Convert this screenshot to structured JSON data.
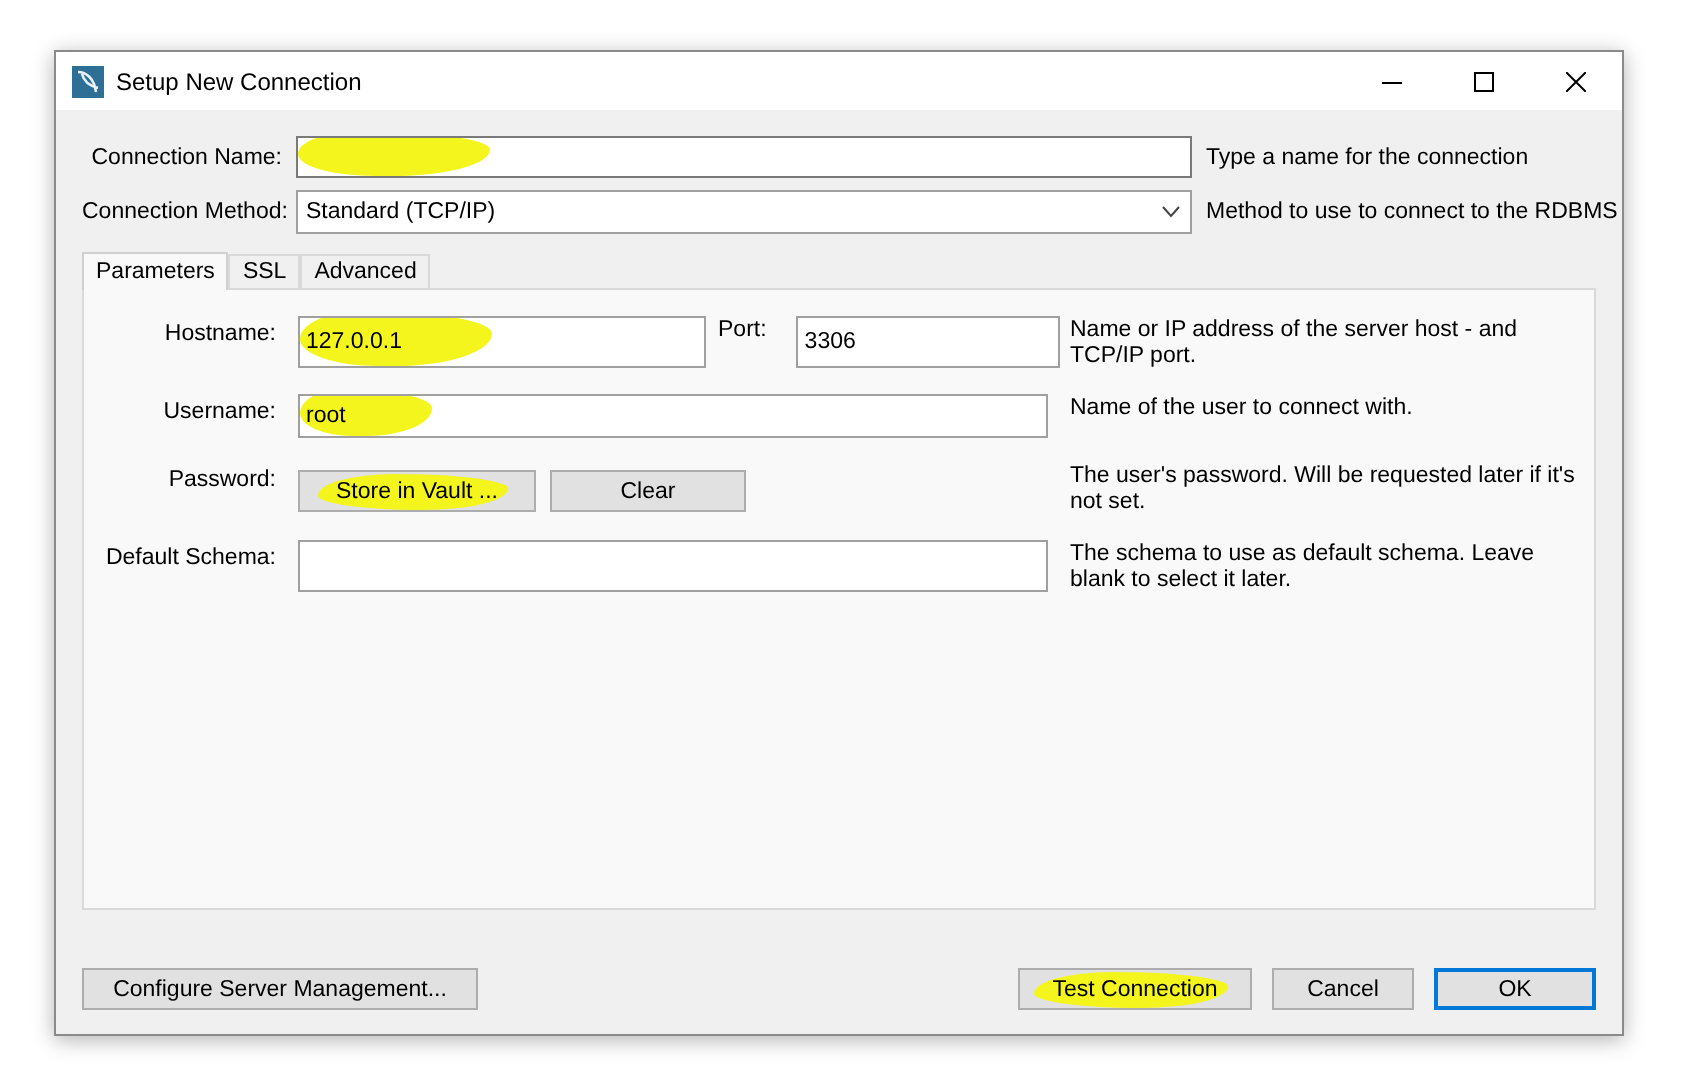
{
  "window": {
    "title": "Setup New Connection"
  },
  "connection_name": {
    "label": "Connection Name:",
    "highlighted": true,
    "hint": "Type a name for the connection"
  },
  "connection_method": {
    "label": "Connection Method:",
    "value": "Standard (TCP/IP)",
    "hint": "Method to use to connect to the RDBMS"
  },
  "tabs": [
    {
      "label": "Parameters",
      "selected": true
    },
    {
      "label": "SSL",
      "selected": false
    },
    {
      "label": "Advanced",
      "selected": false
    }
  ],
  "parameters": [
    {
      "kind": "host",
      "label": "Hostname:",
      "value": "127.0.0.1",
      "highlighted": true,
      "port_label": "Port:",
      "port_value": "3306",
      "hint": "Name or IP address of the server host - and TCP/IP port."
    },
    {
      "kind": "text",
      "label": "Username:",
      "value": "root",
      "highlighted": true,
      "hint": "Name of the user to connect with."
    },
    {
      "kind": "buttons",
      "label": "Password:",
      "buttons": [
        {
          "label": "Store in Vault ...",
          "highlighted": true
        },
        {
          "label": "Clear",
          "highlighted": false
        }
      ],
      "hint": "The user's password. Will be requested later if it's not set."
    },
    {
      "kind": "text",
      "label": "Default Schema:",
      "highlighted": false,
      "hint": "The schema to use as default schema. Leave blank to select it later."
    }
  ],
  "footer_buttons": [
    {
      "label": "Configure Server Management...",
      "highlighted": false,
      "default": false
    },
    {
      "label": "Test Connection",
      "highlighted": true,
      "default": false
    },
    {
      "label": "Cancel",
      "highlighted": false,
      "default": false
    },
    {
      "label": "OK",
      "highlighted": false,
      "default": true
    }
  ]
}
